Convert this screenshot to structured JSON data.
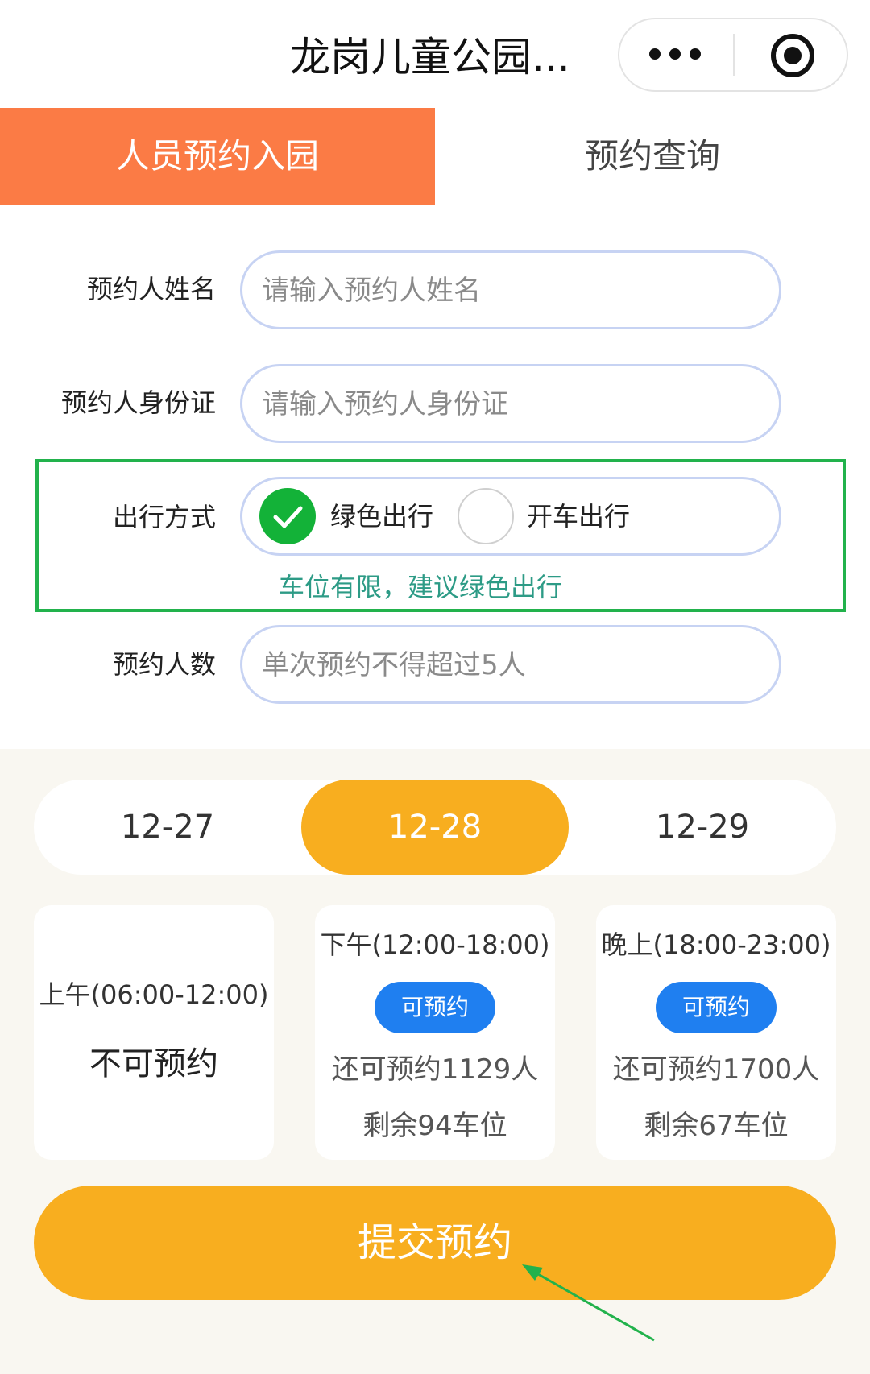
{
  "header": {
    "title": "龙岗儿童公园...",
    "icons": [
      "more-dots-icon",
      "target-icon"
    ]
  },
  "tabs": [
    {
      "label": "人员预约入园",
      "active": true
    },
    {
      "label": "预约查询",
      "active": false
    }
  ],
  "form": {
    "name": {
      "label": "预约人姓名",
      "placeholder": "请输入预约人姓名",
      "value": ""
    },
    "id_card": {
      "label": "预约人身份证",
      "placeholder": "请输入预约人身份证",
      "value": ""
    },
    "travel": {
      "label": "出行方式",
      "options": [
        {
          "label": "绿色出行",
          "selected": true
        },
        {
          "label": "开车出行",
          "selected": false
        }
      ],
      "hint": "车位有限，建议绿色出行"
    },
    "count": {
      "label": "预约人数",
      "placeholder": "单次预约不得超过5人",
      "value": ""
    }
  },
  "dates": [
    {
      "label": "12-27",
      "active": false
    },
    {
      "label": "12-28",
      "active": true
    },
    {
      "label": "12-29",
      "active": false
    }
  ],
  "slots": [
    {
      "time": "上午(06:00-12:00)",
      "status": "不可预约"
    },
    {
      "time": "下午(12:00-18:00)",
      "button": "可预约",
      "remaining": "还可预约1129人",
      "parking": "剩余94车位"
    },
    {
      "time": "晚上(18:00-23:00)",
      "button": "可预约",
      "remaining": "还可预约1700人",
      "parking": "剩余67车位"
    }
  ],
  "submit_label": "提交预约",
  "colors": {
    "tab_active": "#fb7b45",
    "accent": "#f8ae1f",
    "slot_button": "#1f7ff0",
    "radio": "#13b238",
    "highlight": "#22b24c",
    "hint": "#2d9b86"
  }
}
